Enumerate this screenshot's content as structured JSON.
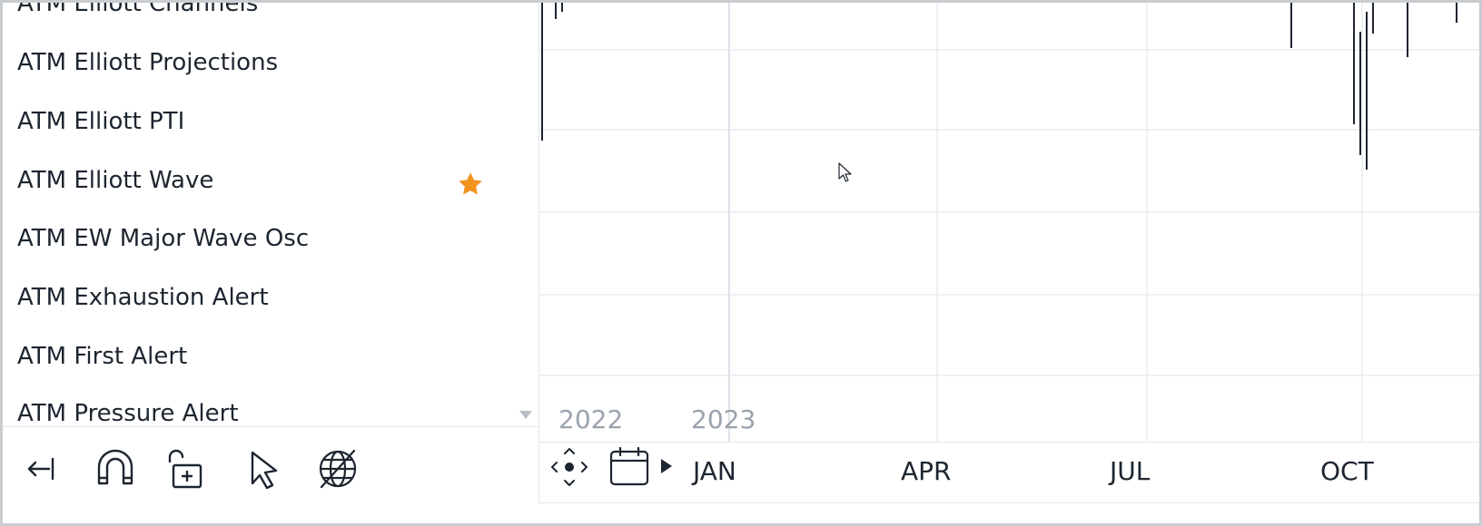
{
  "indicators": [
    {
      "label": "ATM Elliott Channels",
      "favorite": false
    },
    {
      "label": "ATM Elliott Projections",
      "favorite": false
    },
    {
      "label": "ATM Elliott PTI",
      "favorite": false
    },
    {
      "label": "ATM Elliott Wave",
      "favorite": true
    },
    {
      "label": "ATM EW Major Wave Osc",
      "favorite": false
    },
    {
      "label": "ATM Exhaustion Alert",
      "favorite": false
    },
    {
      "label": "ATM First Alert",
      "favorite": false
    },
    {
      "label": "ATM Pressure Alert",
      "favorite": false
    }
  ],
  "toolbar": {
    "icons": [
      "collapse-left-icon",
      "magnet-icon",
      "unlock-add-icon",
      "pointer-icon",
      "globe-off-icon"
    ]
  },
  "chart": {
    "years": [
      "2022",
      "2023"
    ],
    "months": [
      "JAN",
      "APR",
      "JUL",
      "OCT"
    ]
  },
  "colors": {
    "star": "#f2931f",
    "text": "#1d2530",
    "muted": "#9aa3ae",
    "grid": "#e8ebee",
    "bars": "#1d2530"
  }
}
